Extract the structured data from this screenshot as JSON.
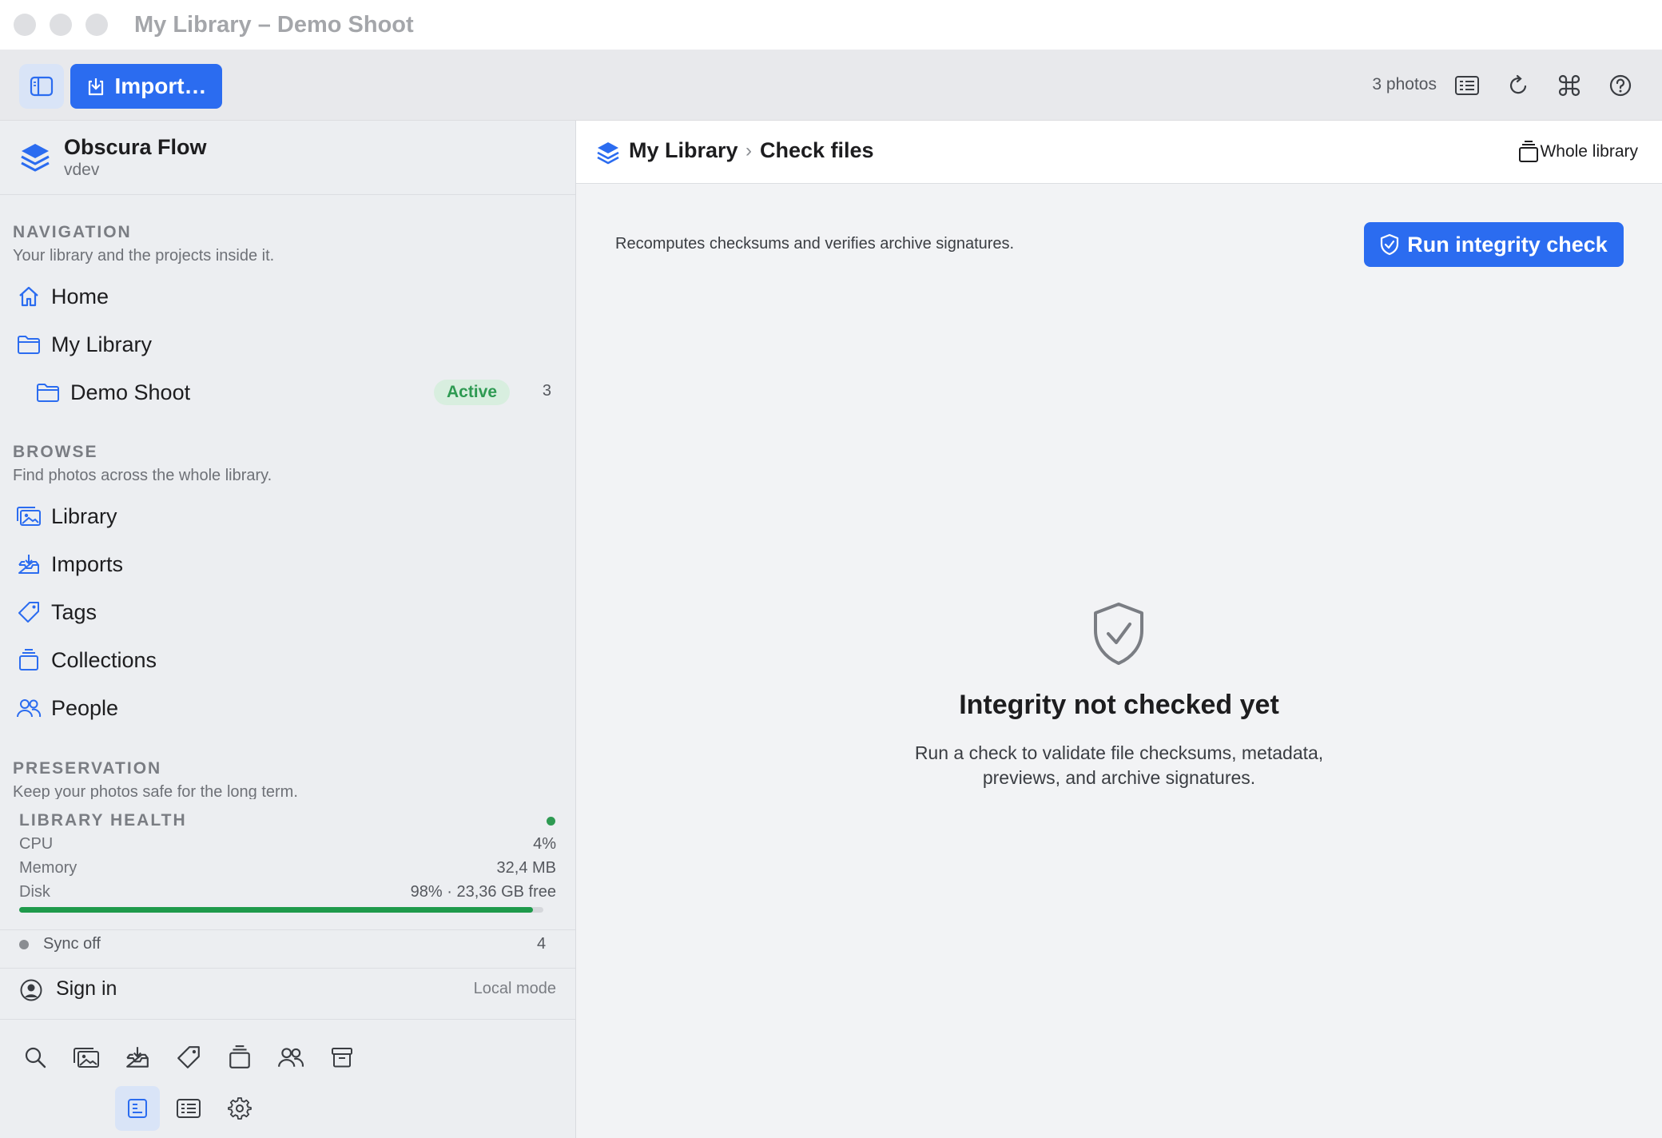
{
  "window": {
    "title": "My Library – Demo Shoot"
  },
  "toolbar": {
    "import_label": "Import…",
    "photo_count": "3 photos"
  },
  "sidebar": {
    "brand": {
      "name": "Obscura Flow",
      "version": "vdev"
    },
    "navigation": {
      "heading": "NAVIGATION",
      "subheading": "Your library and the projects inside it.",
      "items": [
        {
          "label": "Home",
          "icon": "home-icon"
        },
        {
          "label": "My Library",
          "icon": "folder-icon"
        },
        {
          "label": "Demo Shoot",
          "icon": "folder-icon",
          "badge": "Active",
          "count": "3"
        }
      ]
    },
    "browse": {
      "heading": "BROWSE",
      "subheading": "Find photos across the whole library.",
      "items": [
        {
          "label": "Library",
          "icon": "photos-icon"
        },
        {
          "label": "Imports",
          "icon": "inbox-download-icon"
        },
        {
          "label": "Tags",
          "icon": "tag-icon"
        },
        {
          "label": "Collections",
          "icon": "collections-icon"
        },
        {
          "label": "People",
          "icon": "people-icon"
        }
      ]
    },
    "preservation": {
      "heading": "PRESERVATION",
      "subheading": "Keep your photos safe for the long term."
    },
    "health": {
      "heading": "LIBRARY HEALTH",
      "status_color": "#2e9a52",
      "cpu_label": "CPU",
      "cpu_value": "4%",
      "memory_label": "Memory",
      "memory_value": "32,4 MB",
      "disk_label": "Disk",
      "disk_value": "98% · 23,36 GB free",
      "disk_used_fraction": 0.98
    },
    "sync": {
      "label": "Sync off",
      "count": "4"
    },
    "account": {
      "sign_in_label": "Sign in",
      "mode": "Local mode"
    }
  },
  "main": {
    "breadcrumb": {
      "root": "My Library",
      "separator": "›",
      "current": "Check files"
    },
    "scope_label": "Whole library",
    "description": "Recomputes checksums and verifies archive signatures.",
    "run_button": "Run integrity check",
    "empty_state": {
      "title": "Integrity not checked yet",
      "line1": "Run a check to validate file checksums, metadata,",
      "line2": "previews, and archive signatures."
    }
  },
  "colors": {
    "accent": "#2b6cf0",
    "success": "#2e9a52"
  }
}
